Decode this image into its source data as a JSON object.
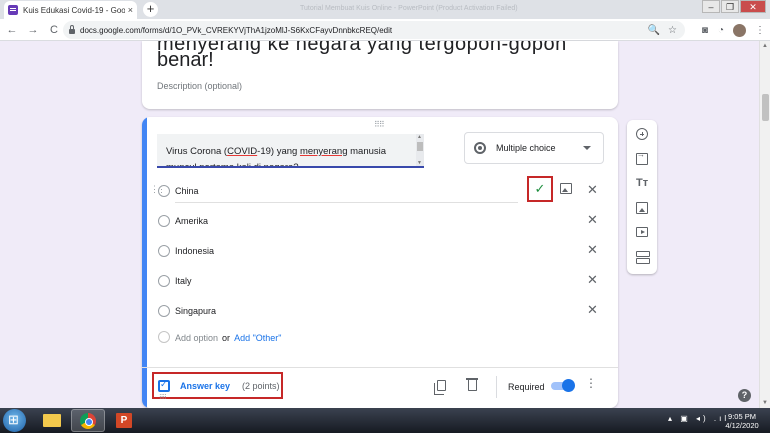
{
  "browser": {
    "tab_title": "Kuis Edukasi Covid-19 - Google F",
    "tab_close": "×",
    "new_tab": "+",
    "faded_title": "Tutorial Membuat Kuis Online - PowerPoint (Product Activation Failed)",
    "url": "docs.google.com/forms/d/1O_PVk_CVREKYVjThA1jzoMlJ-S6KxCFayvDnnbkcREQ/edit",
    "window_controls": {
      "minimize": "–",
      "maximize": "❐",
      "close": "✕"
    },
    "nav": {
      "back": "←",
      "forward": "→",
      "reload": "C"
    },
    "omnibox_icons": {
      "search": "🔍",
      "star": "☆"
    },
    "toolbar_icons": {
      "ext1": "◙",
      "ext2": "◔",
      "menu": "⋮"
    }
  },
  "form": {
    "title_cut": "menyerang ke negara yang tergopoh-gopoh",
    "title_line2": "benar!",
    "description_placeholder": "Description (optional)",
    "question": {
      "text_prefix": "Virus Corona (",
      "text_underlined_1": "COVID",
      "text_mid": "-19) yang ",
      "text_underlined_2": "menyerang",
      "text_suffix": " manusia muncul pertama kali di negara?",
      "type": "Multiple choice",
      "options": [
        "China",
        "Amerika",
        "Indonesia",
        "Italy",
        "Singapura"
      ],
      "correct_check": "✓",
      "close_glyph": "✕",
      "add_option": "Add option",
      "or_text": "or",
      "add_other": "Add \"Other\""
    },
    "footer": {
      "answer_key": "Answer key",
      "points": "(2 points)",
      "required": "Required"
    }
  },
  "side_tools": {
    "title_glyph": "Tт"
  },
  "help": "?",
  "taskbar": {
    "tray": "▴ ▣ ◂) .ıl",
    "time": "9:05 PM",
    "date": "4/12/2020"
  }
}
